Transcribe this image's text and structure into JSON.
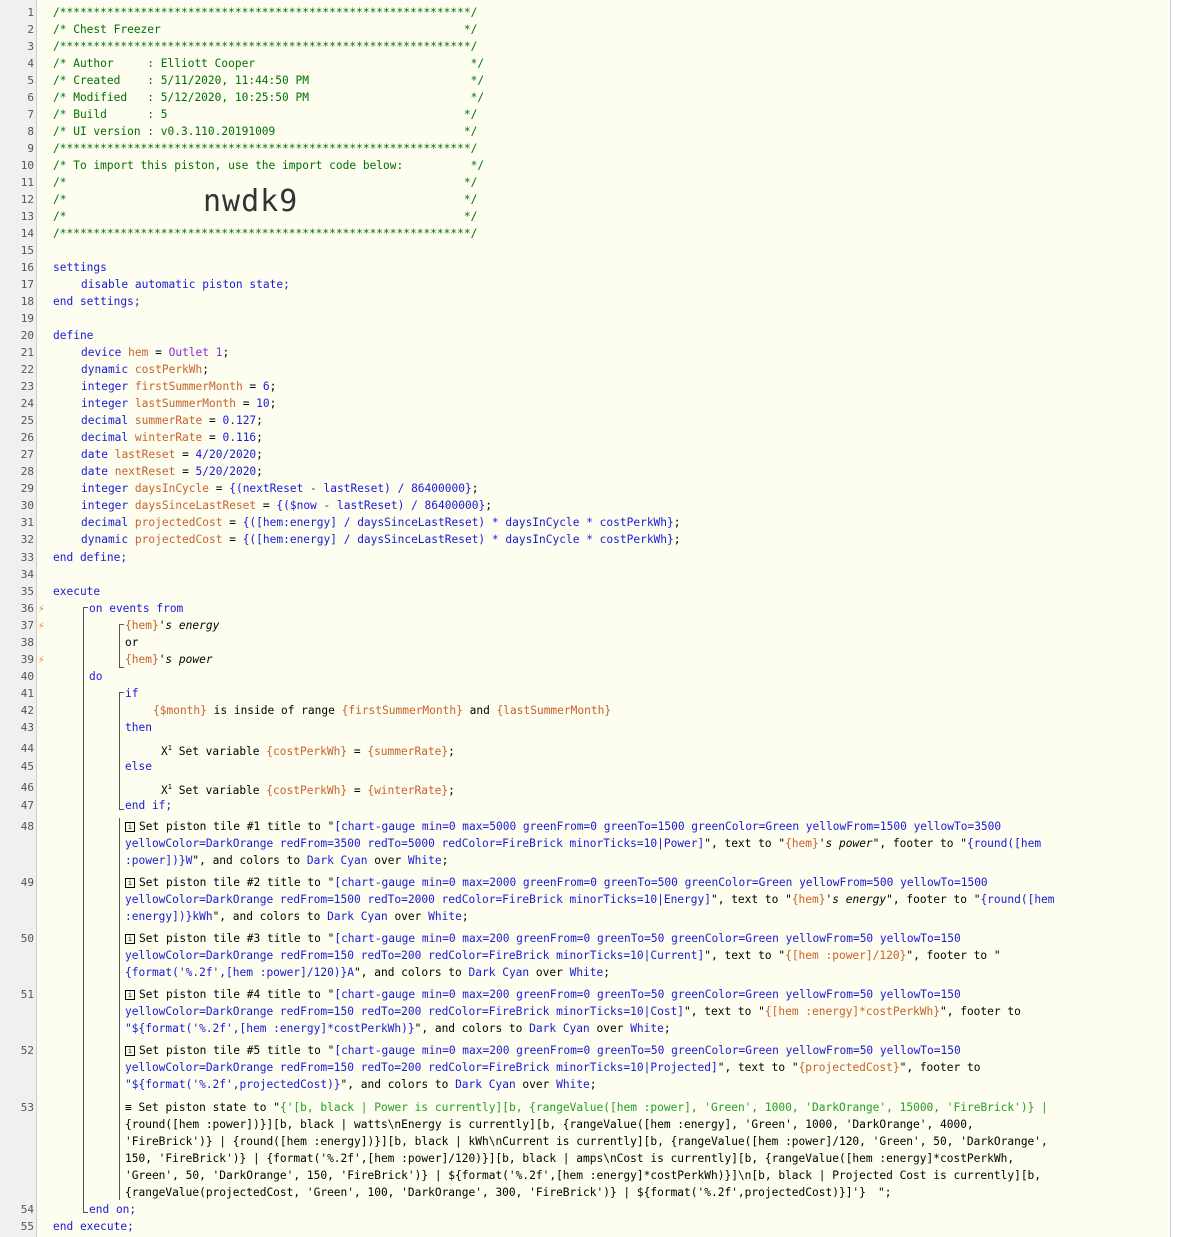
{
  "line_numbers": [
    "1",
    "2",
    "3",
    "4",
    "5",
    "6",
    "7",
    "8",
    "9",
    "10",
    "11",
    "12",
    "13",
    "14",
    "15",
    "16",
    "17",
    "18",
    "19",
    "20",
    "21",
    "22",
    "23",
    "24",
    "25",
    "26",
    "27",
    "28",
    "29",
    "30",
    "31",
    "32",
    "33",
    "34",
    "35",
    "36",
    "37",
    "38",
    "39",
    "40",
    "41",
    "42",
    "43",
    "44",
    "45",
    "46",
    "47",
    "48",
    "49",
    "50",
    "51",
    "52",
    "53",
    "54",
    "55"
  ],
  "header": {
    "border": "/*************************************************************/",
    "title": "/* Chest Freezer                                             */",
    "author": "/* Author     : Elliott Cooper                                */",
    "created": "/* Created    : 5/11/2020, 11:44:50 PM                        */",
    "modified": "/* Modified   : 5/12/2020, 10:25:50 PM                        */",
    "build": "/* Build      : 5                                            */",
    "ui_version": "/* UI version : v0.3.110.20191009                            */",
    "import_hint": "/* To import this piston, use the import code below:          */",
    "blank": "/*                                                           */",
    "import_code": "nwdk9"
  },
  "settings": {
    "open": "settings",
    "body": "disable automatic piston state;",
    "close": "end settings;"
  },
  "define": {
    "open": "define",
    "close": "end define;",
    "vars": [
      {
        "type": "device",
        "name": "hem",
        "eq": " = ",
        "value": "Outlet 1",
        "end": ";"
      },
      {
        "type": "dynamic",
        "name": "costPerkWh",
        "eq": "",
        "value": "",
        "end": ";"
      },
      {
        "type": "integer",
        "name": "firstSummerMonth",
        "eq": " = ",
        "value": "6",
        "end": ";"
      },
      {
        "type": "integer",
        "name": "lastSummerMonth",
        "eq": " = ",
        "value": "10",
        "end": ";"
      },
      {
        "type": "decimal",
        "name": "summerRate",
        "eq": " = ",
        "value": "0.127",
        "end": ";"
      },
      {
        "type": "decimal",
        "name": "winterRate",
        "eq": " = ",
        "value": "0.116",
        "end": ";"
      },
      {
        "type": "date",
        "name": "lastReset",
        "eq": " = ",
        "value": "4/20/2020",
        "end": ";"
      },
      {
        "type": "date",
        "name": "nextReset",
        "eq": " = ",
        "value": "5/20/2020",
        "end": ";"
      },
      {
        "type": "integer",
        "name": "daysInCycle",
        "eq": " = ",
        "value": "{(nextReset - lastReset) / 86400000}",
        "end": ";"
      },
      {
        "type": "integer",
        "name": "daysSinceLastReset",
        "eq": " = ",
        "value": "{($now - lastReset) / 86400000}",
        "end": ";"
      },
      {
        "type": "decimal",
        "name": "projectedCost",
        "eq": " = ",
        "value": "{([hem:energy] / daysSinceLastReset) * daysInCycle * costPerkWh}",
        "end": ";"
      },
      {
        "type": "dynamic",
        "name": "projectedCost",
        "eq": " = ",
        "value": "{([hem:energy] / daysSinceLastReset) * daysInCycle * costPerkWh}",
        "end": ";"
      }
    ]
  },
  "execute": {
    "open": "execute",
    "on_events": "on events from",
    "event1_dev": "{hem}",
    "event1_attr": "'s energy",
    "or": "or",
    "event2_dev": "{hem}",
    "event2_attr": "'s power",
    "do": "do",
    "if": "if",
    "cond_var": "{$month}",
    "cond_op": " is inside of range ",
    "cond_a": "{firstSummerMonth}",
    "cond_and": " and ",
    "cond_b": "{lastSummerMonth}",
    "then": "then",
    "set_var": "Set variable ",
    "set_target": "{costPerkWh}",
    "set_eq": " = ",
    "summer_val": "{summerRate}",
    "else": "else",
    "winter_val": "{winterRate}",
    "end_if": "end if;",
    "end_on": "end on;",
    "close": "end execute;"
  },
  "tiles": [
    {
      "l1a": "Set piston tile #1 title to \"",
      "l1b": "[chart-gauge min=0 max=5000 greenFrom=0 greenTo=1500 greenColor=Green yellowFrom=1500 yellowTo=3500",
      "l2a": "yellowColor=DarkOrange redFrom=3500 redTo=5000 redColor=FireBrick minorTicks=10|Power]",
      "l2b": "\", text to \"",
      "l2c": "{hem}",
      "l2d": "'s ",
      "l2e": "power",
      "l2f": "\", footer to \"",
      "l2g": "{round([hem",
      "l3a": ":power])}W",
      "l3b": "\", and colors to ",
      "l3c": "Dark Cyan",
      "l3d": " over ",
      "l3e": "White",
      "l3f": ";"
    },
    {
      "l1a": "Set piston tile #2 title to \"",
      "l1b": "[chart-gauge min=0 max=2000 greenFrom=0 greenTo=500 greenColor=Green yellowFrom=500 yellowTo=1500",
      "l2a": "yellowColor=DarkOrange redFrom=1500 redTo=2000 redColor=FireBrick minorTicks=10|Energy]",
      "l2b": "\", text to \"",
      "l2c": "{hem}",
      "l2d": "'s ",
      "l2e": "energy",
      "l2f": "\", footer to \"",
      "l2g": "{round([hem",
      "l3a": ":energy])}kWh",
      "l3b": "\", and colors to ",
      "l3c": "Dark Cyan",
      "l3d": " over ",
      "l3e": "White",
      "l3f": ";"
    },
    {
      "l1a": "Set piston tile #3 title to \"",
      "l1b": "[chart-gauge min=0 max=200 greenFrom=0 greenTo=50 greenColor=Green yellowFrom=50 yellowTo=150",
      "l2a": "yellowColor=DarkOrange redFrom=150 redTo=200 redColor=FireBrick minorTicks=10|Current]",
      "l2b": "\", text to \"",
      "l2c": "{[hem :power]/120}",
      "l2d": "",
      "l2e": "",
      "l2f": "\", footer to \"",
      "l2g": "",
      "l3a": "{format('%.2f',[hem :power]/120)}A",
      "l3b": "\", and colors to ",
      "l3c": "Dark Cyan",
      "l3d": " over ",
      "l3e": "White",
      "l3f": ";"
    },
    {
      "l1a": "Set piston tile #4 title to \"",
      "l1b": "[chart-gauge min=0 max=200 greenFrom=0 greenTo=50 greenColor=Green yellowFrom=50 yellowTo=150",
      "l2a": "yellowColor=DarkOrange redFrom=150 redTo=200 redColor=FireBrick minorTicks=10|Cost]",
      "l2b": "\", text to \"",
      "l2c": "{[hem :energy]*costPerkWh}",
      "l2d": "",
      "l2e": "",
      "l2f": "\", footer to",
      "l2g": "",
      "l3a": "\"${format('%.2f',[hem :energy]*costPerkWh)}",
      "l3b": "\", and colors to ",
      "l3c": "Dark Cyan",
      "l3d": " over ",
      "l3e": "White",
      "l3f": ";"
    },
    {
      "l1a": "Set piston tile #5 title to \"",
      "l1b": "[chart-gauge min=0 max=200 greenFrom=0 greenTo=50 greenColor=Green yellowFrom=50 yellowTo=150",
      "l2a": "yellowColor=DarkOrange redFrom=150 redTo=200 redColor=FireBrick minorTicks=10|Projected]",
      "l2b": "\", text to \"",
      "l2c": "{projectedCost}",
      "l2d": "",
      "l2e": "",
      "l2f": "\", footer to",
      "l2g": "",
      "l3a": "\"${format('%.2f',projectedCost)}",
      "l3b": "\", and colors to ",
      "l3c": "Dark Cyan",
      "l3d": " over ",
      "l3e": "White",
      "l3f": ";"
    }
  ],
  "state": {
    "prefix": "Set piston state to \"",
    "lines": [
      "{'[b, black | Power is currently][b, {rangeValue([hem :power], 'Green', 1000, 'DarkOrange', 15000, 'FireBrick')} |",
      "{round([hem :power])}][b, black | watts\\nEnergy is currently][b, {rangeValue([hem :energy], 'Green', 1000, 'DarkOrange', 4000,",
      "'FireBrick')} | {round([hem :energy])}][b, black | kWh\\nCurrent is currently][b, {rangeValue([hem :power]/120, 'Green', 50, 'DarkOrange',",
      "150, 'FireBrick')} | {format('%.2f',[hem :power]/120)}][b, black | amps\\nCost is currently][b, {rangeValue([hem :energy]*costPerkWh,",
      "'Green', 50, 'DarkOrange', 150, 'FireBrick')} | ${format('%.2f',[hem :energy]*costPerkWh)}]\\n[b, black | Projected Cost is currently][b,",
      "{rangeValue(projectedCost, 'Green', 100, 'DarkOrange', 300, 'FireBrick')} | ${format('%.2f',projectedCost)}]'}"
    ],
    "suffix": "\";"
  },
  "icons": {
    "bolt": "⚡",
    "tile_icon": "i",
    "state_icon": "≡",
    "var_icon": "X"
  }
}
